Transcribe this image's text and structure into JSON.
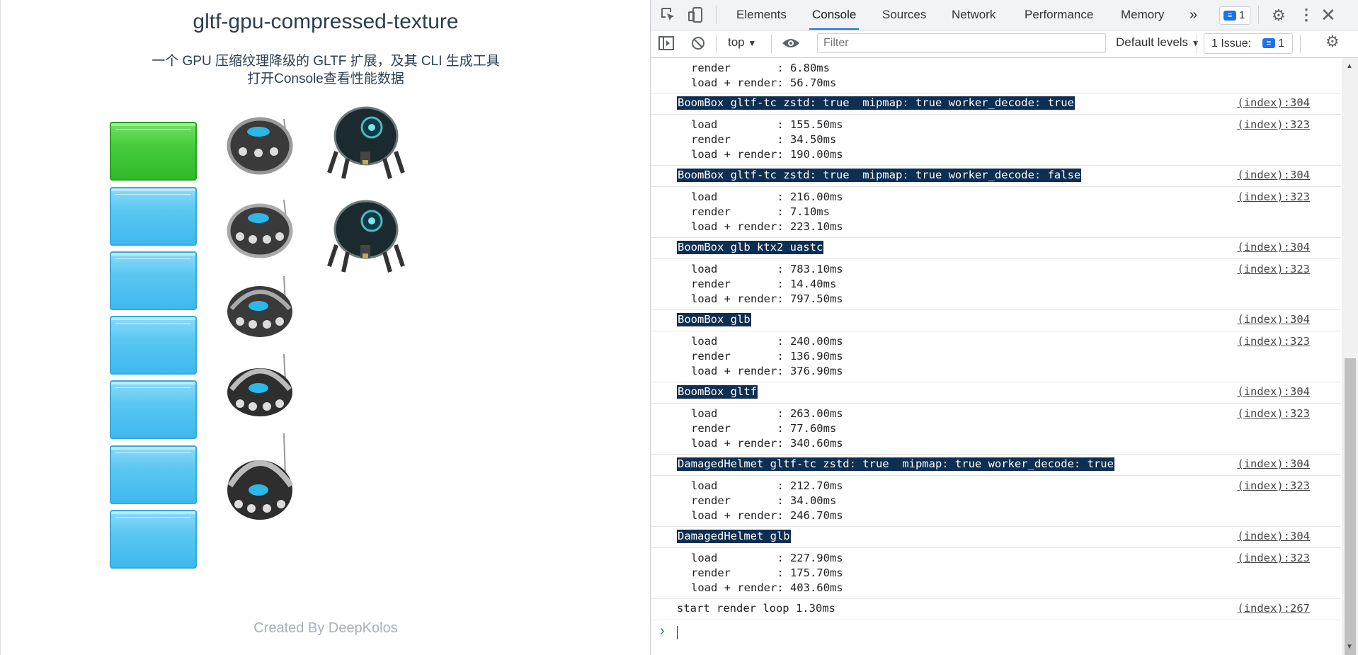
{
  "page": {
    "title": "gltf-gpu-compressed-texture",
    "subtitle_line1": "一个 GPU 压缩纹理降级的 GLTF 扩展，及其 CLI 生成工具",
    "subtitle_line2": "打开Console查看性能数据",
    "footer": "Created By DeepKolos"
  },
  "devtools": {
    "tabs": [
      "Elements",
      "Console",
      "Sources",
      "Network",
      "Performance",
      "Memory"
    ],
    "active_tab": "Console",
    "more_tabs_glyph": "»",
    "messages_badge": "1",
    "context_select": "top",
    "filter_placeholder": "Filter",
    "levels_select": "Default levels",
    "issues_label": "1 Issue:",
    "issues_count": "1",
    "prompt_glyph": "›"
  },
  "console": {
    "top_partial": {
      "lines": [
        "render       : 6.80ms",
        "load + render: 56.70ms"
      ]
    },
    "groups": [
      {
        "header": "BoomBox gltf-tc zstd: true  mipmap: true worker_decode: true",
        "header_src": "(index):304",
        "body_src": "(index):323",
        "lines": [
          "load         : 155.50ms",
          "render       : 34.50ms",
          "load + render: 190.00ms"
        ]
      },
      {
        "header": "BoomBox gltf-tc zstd: true  mipmap: true worker_decode: false",
        "header_src": "(index):304",
        "body_src": "(index):323",
        "lines": [
          "load         : 216.00ms",
          "render       : 7.10ms",
          "load + render: 223.10ms"
        ]
      },
      {
        "header": "BoomBox glb ktx2 uastc",
        "header_src": "(index):304",
        "body_src": "(index):323",
        "lines": [
          "load         : 783.10ms",
          "render       : 14.40ms",
          "load + render: 797.50ms"
        ]
      },
      {
        "header": "BoomBox glb",
        "header_src": "(index):304",
        "body_src": "(index):323",
        "lines": [
          "load         : 240.00ms",
          "render       : 136.90ms",
          "load + render: 376.90ms"
        ]
      },
      {
        "header": "BoomBox gltf",
        "header_src": "(index):304",
        "body_src": "(index):323",
        "lines": [
          "load         : 263.00ms",
          "render       : 77.60ms",
          "load + render: 340.60ms"
        ]
      },
      {
        "header": "DamagedHelmet gltf-tc zstd: true  mipmap: true worker_decode: true",
        "header_src": "(index):304",
        "body_src": "(index):323",
        "lines": [
          "load         : 212.70ms",
          "render       : 34.00ms",
          "load + render: 246.70ms"
        ]
      },
      {
        "header": "DamagedHelmet glb",
        "header_src": "(index):304",
        "body_src": "(index):323",
        "lines": [
          "load         : 227.90ms",
          "render       : 175.70ms",
          "load + render: 403.60ms"
        ]
      }
    ],
    "final": {
      "text": "start render loop 1.30ms",
      "src": "(index):267"
    }
  },
  "colors": {
    "group_header_bg": "#0e2e52",
    "accent": "#1a73e8",
    "pouch_blue": "#5ac7f2",
    "pouch_green": "#47cc3b"
  },
  "icons": [
    "inspect-icon",
    "device-toggle-icon",
    "settings-gear-icon",
    "more-vert-icon",
    "close-icon",
    "sidebar-toggle-icon",
    "clear-console-icon",
    "eye-icon",
    "prompt-chevron-icon"
  ]
}
